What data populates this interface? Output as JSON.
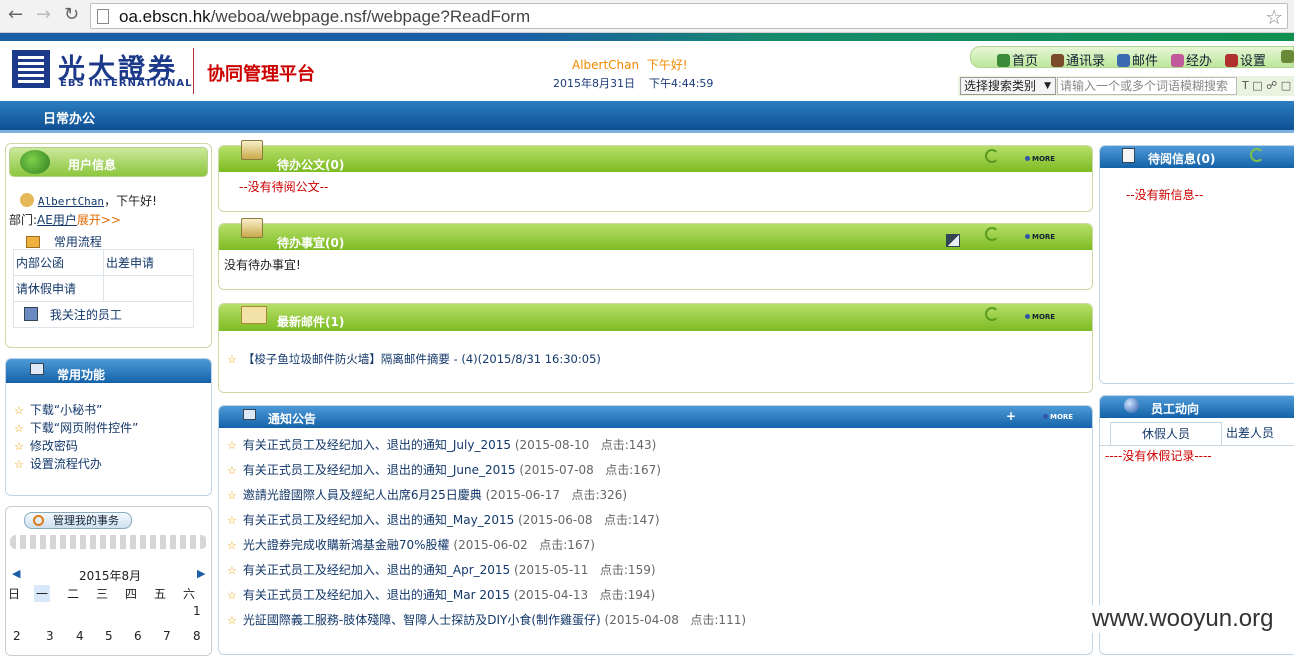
{
  "browser": {
    "url_host": "oa.ebscn.hk",
    "url_path": "/weboa/webpage.nsf/webpage?ReadForm"
  },
  "header": {
    "logo_cn": "光大證券",
    "logo_en": "EBS INTERNATIONAL",
    "platform": "协同管理平台",
    "user": "AlbertChan",
    "greeting": "下午好!",
    "date": "2015年8月31日",
    "time": "下午4:44:59",
    "nav": [
      {
        "label": "首页",
        "icon": "home-icon"
      },
      {
        "label": "通讯录",
        "icon": "contacts-icon"
      },
      {
        "label": "邮件",
        "icon": "mail-icon"
      },
      {
        "label": "经办",
        "icon": "task-icon"
      },
      {
        "label": "设置",
        "icon": "settings-icon"
      }
    ],
    "search_category": "选择搜索类别",
    "search_placeholder": "请输入一个或多个词语模糊搜索",
    "search_tools": "T"
  },
  "menu": {
    "tab": "日常办公"
  },
  "user_panel": {
    "title": "用户信息",
    "user": "AlbertChan",
    "greeting": "，下午好!",
    "dept_label": "部门:",
    "dept": "AE用户",
    "expand": "展开>>",
    "common_flow": "常用流程",
    "flows": [
      [
        "内部公函",
        "出差申请"
      ],
      [
        "请休假申请",
        ""
      ]
    ],
    "followed": "我关注的员工"
  },
  "functions_panel": {
    "title": "常用功能",
    "items": [
      "下载“小秘书”",
      "下载“网页附件控件”",
      "修改密码",
      "设置流程代办"
    ]
  },
  "manage": {
    "label": "管理我的事务"
  },
  "calendar": {
    "month": "2015年8月",
    "weekdays": [
      "日",
      "一",
      "二",
      "三",
      "四",
      "五",
      "六"
    ],
    "row1": [
      "",
      "",
      "",
      "",
      "",
      "",
      "1"
    ],
    "row2": [
      "2",
      "3",
      "4",
      "5",
      "6",
      "7",
      "8"
    ]
  },
  "pending_docs": {
    "title": "待办公文(0)",
    "empty": "--没有待阅公文--",
    "more": "MORE"
  },
  "pending_tasks": {
    "title": "待办事宜(0)",
    "empty": "没有待办事宜!",
    "more": "MORE"
  },
  "latest_mail": {
    "title": "最新邮件(1)",
    "more": "MORE",
    "items": [
      {
        "text": "【梭子鱼垃圾邮件防火墙】隔离邮件摘要 - (4)(2015/8/31 16:30:05)"
      }
    ]
  },
  "notices": {
    "title": "通知公告",
    "more": "MORE",
    "items": [
      {
        "title": "有关正式员工及经纪加入、退出的通知_July_2015",
        "date": "(2015-08-10",
        "clicks": "点击:143)"
      },
      {
        "title": "有关正式员工及经纪加入、退出的通知_June_2015",
        "date": "(2015-07-08",
        "clicks": "点击:167)"
      },
      {
        "title": "邀請光證國際人員及經紀人出席6月25日慶典",
        "date": "(2015-06-17",
        "clicks": "点击:326)"
      },
      {
        "title": "有关正式员工及经纪加入、退出的通知_May_2015",
        "date": "(2015-06-08",
        "clicks": "点击:147)"
      },
      {
        "title": "光大證券完成收購新鴻基金融70%股權",
        "date": "(2015-06-02",
        "clicks": "点击:167)"
      },
      {
        "title": "有关正式员工及经纪加入、退出的通知_Apr_2015",
        "date": "(2015-05-11",
        "clicks": "点击:159)"
      },
      {
        "title": "有关正式员工及经纪加入、退出的通知_Mar 2015",
        "date": "(2015-04-13",
        "clicks": "点击:194)"
      },
      {
        "title": "光証國際義工服務-肢体殘障、智障人士探訪及DIY小食(制作雞蛋仔)",
        "date": "(2015-04-08",
        "clicks": "点击:111)"
      }
    ]
  },
  "pending_read": {
    "title": "待阅信息(0)",
    "empty": "--没有新信息--"
  },
  "staff": {
    "title": "员工动向",
    "tabs": [
      "休假人员",
      "出差人员"
    ],
    "empty": "----没有休假记录----"
  },
  "watermark": "www.wooyun.org"
}
